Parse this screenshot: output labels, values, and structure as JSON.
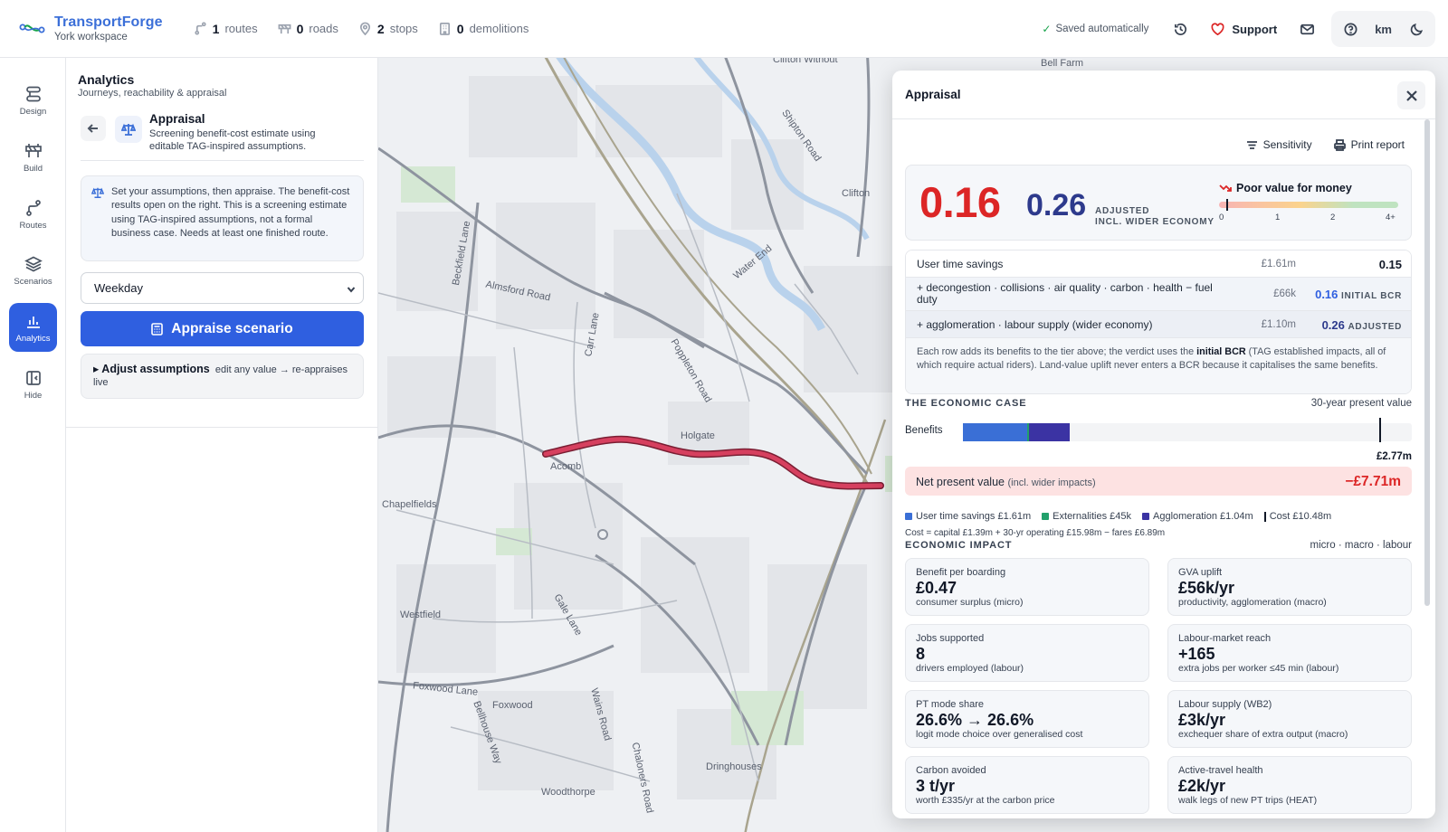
{
  "app": {
    "name": "TransportForge",
    "workspace": "York workspace",
    "counters": [
      {
        "num": "1",
        "label": "routes",
        "icon": "route-icon"
      },
      {
        "num": "0",
        "label": "roads",
        "icon": "road-barrier-icon"
      },
      {
        "num": "2",
        "label": "stops",
        "icon": "map-pin-icon"
      },
      {
        "num": "0",
        "label": "demolitions",
        "icon": "building-icon"
      }
    ],
    "saved": "Saved automatically",
    "support": "Support",
    "units": "km"
  },
  "rail": [
    {
      "label": "Design",
      "icon": "design-icon"
    },
    {
      "label": "Build",
      "icon": "build-icon"
    },
    {
      "label": "Routes",
      "icon": "routes-icon"
    },
    {
      "label": "Scenarios",
      "icon": "layers-icon"
    },
    {
      "label": "Analytics",
      "icon": "bar-chart-icon",
      "active": true
    },
    {
      "label": "Hide",
      "icon": "hide-panel-icon"
    }
  ],
  "sidebar": {
    "title": "Analytics",
    "subtitle": "Journeys, reachability & appraisal",
    "tool_title": "Appraisal",
    "tool_desc": "Screening benefit-cost estimate using editable TAG-inspired assumptions.",
    "info": "Set your assumptions, then appraise. The benefit-cost results open on the right. This is a screening estimate using TAG-inspired assumptions, not a formal business case. Needs at least one finished route.",
    "day_select": "Weekday",
    "appraise_button": "Appraise scenario",
    "adjust_title": "Adjust assumptions",
    "adjust_hint": "edit any value → re-appraises live"
  },
  "map_labels": [
    "Clifton Without",
    "Bell Farm",
    "Clifton",
    "Water End",
    "Almsford Road",
    "Beckfield Lane",
    "Carr Lane",
    "Poppleton Road",
    "Holgate",
    "Acomb",
    "Chapelfields",
    "Westfield",
    "Gale Lane",
    "Foxwood Lane",
    "Foxwood",
    "Bellhouse Way",
    "Wains Road",
    "Chaloners Road",
    "Dringhouses",
    "Woodthorpe",
    "Shipton Road",
    "Water End"
  ],
  "panel": {
    "title": "Appraisal",
    "sensitivity": "Sensitivity",
    "print": "Print report",
    "bcr": "0.16",
    "bcr_adjusted": "0.26",
    "adjusted_caption_1": "ADJUSTED",
    "adjusted_caption_2": "INCL. WIDER ECONOMY",
    "verdict": "Poor value for money",
    "verdict_value": 0.16,
    "scale_ticks": [
      "0",
      "1",
      "2",
      "4+"
    ],
    "tiers": [
      {
        "label": "User time savings",
        "amount": "£1.61m",
        "value": "0.15",
        "tag": ""
      },
      {
        "label": "+ decongestion · collisions · air quality · carbon · health − fuel duty",
        "amount": "£66k",
        "value": "0.16",
        "tag": "INITIAL BCR"
      },
      {
        "label": "+ agglomeration · labour supply (wider economy)",
        "amount": "£1.10m",
        "value": "0.26",
        "tag": "ADJUSTED"
      }
    ],
    "tier_note_pre": "Each row adds its benefits to the tier above; the verdict uses the ",
    "tier_note_bold": "initial BCR",
    "tier_note_post": " (TAG established impacts, all of which require actual riders). Land-value uplift never enters a BCR because it capitalises the same benefits.",
    "economic_case": "THE ECONOMIC CASE",
    "present_value": "30-year present value",
    "benefits_label": "Benefits",
    "benefits_total": "£2.77m",
    "npv_label": "Net present value",
    "npv_note": "(incl. wider impacts)",
    "npv_value": "−£7.71m",
    "legend": [
      {
        "label": "User time savings £1.61m",
        "color": "#3a6fd6",
        "value_m": 1.61
      },
      {
        "label": "Externalities £45k",
        "color": "#22a06b",
        "value_m": 0.045
      },
      {
        "label": "Agglomeration £1.04m",
        "color": "#3b33a3",
        "value_m": 1.04
      }
    ],
    "cost_label": "Cost £10.48m",
    "cost_value_m": 10.48,
    "formula": "Cost = capital £1.39m + 30-yr operating £15.98m − fares £6.89m",
    "impact_title": "ECONOMIC IMPACT",
    "impact_scope": "micro · macro · labour",
    "cards": [
      {
        "k": "Benefit per boarding",
        "v": "£0.47",
        "d": "consumer surplus (micro)"
      },
      {
        "k": "GVA uplift",
        "v": "£56k/yr",
        "d": "productivity, agglomeration (macro)"
      },
      {
        "k": "Jobs supported",
        "v": "8",
        "d": "drivers employed (labour)"
      },
      {
        "k": "Labour-market reach",
        "v": "+165",
        "d": "extra jobs per worker ≤45 min (labour)"
      },
      {
        "k": "PT mode share",
        "v": "26.6% → 26.6%",
        "d": "logit mode choice over generalised cost"
      },
      {
        "k": "Labour supply (WB2)",
        "v": "£3k/yr",
        "d": "exchequer share of extra output (macro)"
      },
      {
        "k": "Carbon avoided",
        "v": "3 t/yr",
        "d": "worth £335/yr at the carbon price"
      },
      {
        "k": "Active-travel health",
        "v": "£2k/yr",
        "d": "walk legs of new PT trips (HEAT)"
      }
    ]
  },
  "colors": {
    "accent": "#2f5fe0",
    "brand": "#3b6fd8",
    "bad": "#dc2626",
    "route": "#d6405f"
  }
}
